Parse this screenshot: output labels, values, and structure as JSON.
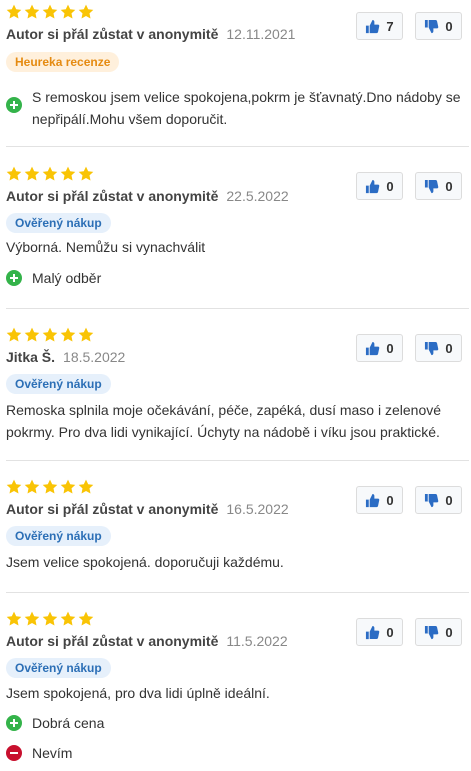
{
  "colors": {
    "star": "#f9c405",
    "thumb": "#2b6cc4",
    "positive": "#34b34a",
    "negative": "#c8102e"
  },
  "reviews": [
    {
      "author": "Autor si přál zůstat v anonymitě",
      "date": "12.11.2021",
      "badge": "Heureka recenze",
      "text": "",
      "pros": [
        "S remoskou jsem velice spokojena,pokrm je šťavnatý.Dno nádoby se nepřipálí.Mohu všem doporučit."
      ],
      "cons": [],
      "likes": "7",
      "dislikes": "0",
      "rating": 5
    },
    {
      "author": "Autor si přál zůstat v anonymitě",
      "date": "22.5.2022",
      "badge": "Ověřený nákup",
      "text": "Výborná. Nemůžu si vynachválit",
      "pros": [
        "Malý odběr"
      ],
      "cons": [],
      "likes": "0",
      "dislikes": "0",
      "rating": 5
    },
    {
      "author": "Jitka Š.",
      "date": "18.5.2022",
      "badge": "Ověřený nákup",
      "text": "Remoska splnila moje očekávání, péče, zapéká, dusí maso i zelenové pokrmy. Pro dva lidi vynikající. Úchyty na nádobě i víku jsou praktické.",
      "pros": [],
      "cons": [],
      "likes": "0",
      "dislikes": "0",
      "rating": 5
    },
    {
      "author": "Autor si přál zůstat v anonymitě",
      "date": "16.5.2022",
      "badge": "Ověřený nákup",
      "text": "Jsem velice spokojená. doporučuji každému.",
      "pros": [],
      "cons": [],
      "likes": "0",
      "dislikes": "0",
      "rating": 5
    },
    {
      "author": "Autor si přál zůstat v anonymitě",
      "date": "11.5.2022",
      "badge": "Ověřený nákup",
      "text": "Jsem spokojená, pro dva lidi úplně ideální.",
      "pros": [
        "Dobrá cena"
      ],
      "cons": [
        "Nevím"
      ],
      "likes": "0",
      "dislikes": "0",
      "rating": 5
    }
  ]
}
